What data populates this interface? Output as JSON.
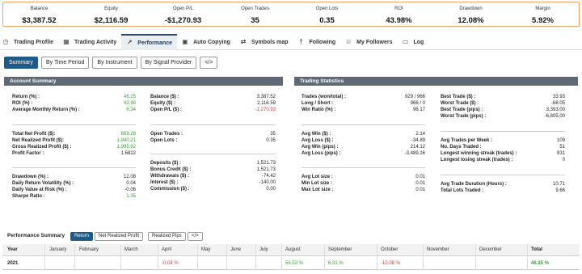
{
  "stats": [
    {
      "label": "Balance",
      "value": "$3,387.52"
    },
    {
      "label": "Equity",
      "value": "$2,116.59"
    },
    {
      "label": "Open P/L",
      "value": "-$1,270.93"
    },
    {
      "label": "Open Trades",
      "value": "35"
    },
    {
      "label": "Open Lots",
      "value": "0.35"
    },
    {
      "label": "ROI",
      "value": "43.98%"
    },
    {
      "label": "Drawdown",
      "value": "12.08%"
    },
    {
      "label": "Margin",
      "value": "5.92%"
    }
  ],
  "tabs": [
    {
      "label": "Trading Profile",
      "icon": "clock-icon"
    },
    {
      "label": "Trading Activity",
      "icon": "calendar-icon"
    },
    {
      "label": "Performance",
      "icon": "chart-line-icon"
    },
    {
      "label": "Auto Copying",
      "icon": "briefcase-icon"
    },
    {
      "label": "Symbols map",
      "icon": "arrows-icon"
    },
    {
      "label": "Following",
      "icon": "walking-person-icon"
    },
    {
      "label": "My Followers",
      "icon": "people-icon"
    },
    {
      "label": "Log",
      "icon": "document-icon"
    }
  ],
  "active_tab": "Performance",
  "subtabs": {
    "summary": "Summary",
    "by_time_period": "By Time Period",
    "by_instrument": "By Instrument",
    "by_signal_provider": "By Signal Provider",
    "embed": "</>"
  },
  "account_summary": {
    "title": "Account Summary",
    "left_groups": [
      [
        {
          "label": "Return (%) :",
          "value": "46.25",
          "color": "green"
        },
        {
          "label": "ROI (%) :",
          "value": "43.98",
          "color": "green"
        },
        {
          "label": "Average Monthly Return (%) :",
          "value": "6.34",
          "color": "green"
        }
      ],
      [
        {
          "label": "Total Net Profit ($):",
          "value": "669.28",
          "color": "green"
        },
        {
          "label": "Net Realized Profit ($):",
          "value": "1,940.21",
          "color": "green"
        },
        {
          "label": "Gross Realized Profit ($) :",
          "value": "1,995.62",
          "color": "green"
        },
        {
          "label": "Profit Factor :",
          "value": "1.6822",
          "color": "dark"
        }
      ],
      [
        {
          "label": "Drawdown (%) :",
          "value": "12.08",
          "color": "dark"
        },
        {
          "label": "Daily Return Volatility (%) :",
          "value": "0.04",
          "color": "dark"
        },
        {
          "label": "Daily Value at Risk (%) :",
          "value": "-0.06",
          "color": "dark"
        },
        {
          "label": "Sharpe Ratio :",
          "value": "1.35",
          "color": "green"
        }
      ]
    ],
    "right_groups": [
      [
        {
          "label": "Balance ($) :",
          "value": "3,387.52",
          "color": "dark"
        },
        {
          "label": "Equity ($) :",
          "value": "2,116.59",
          "color": "dark"
        },
        {
          "label": "Open P/L ($) :",
          "value": "-1,270.93",
          "color": "red"
        }
      ],
      [
        {
          "label": "Open Trades :",
          "value": "35",
          "color": "dark"
        },
        {
          "label": "Open Lots :",
          "value": "0.35",
          "color": "dark"
        }
      ],
      [
        {
          "label": "Deposits ($) :",
          "value": "1,521.73",
          "color": "dark"
        },
        {
          "label": "Bonus Credit ($) :",
          "value": "1,521.73",
          "color": "dark"
        },
        {
          "label": "Withdrawals ($) :",
          "value": "-74.42",
          "color": "dark"
        },
        {
          "label": "Interest ($) :",
          "value": "-140.00",
          "color": "dark"
        },
        {
          "label": "Commission ($) :",
          "value": "0.00",
          "color": "dark"
        }
      ]
    ]
  },
  "trading_statistics": {
    "title": "Trading Statistics",
    "left_groups": [
      [
        {
          "label": "Trades (won/total) :",
          "value": "929 / 966"
        },
        {
          "label": "Long / Short :",
          "value": "966 / 0"
        },
        {
          "label": "Win Ratio (%) :",
          "value": "96.17"
        }
      ],
      [
        {
          "label": "Avg Win ($) :",
          "value": "2.14"
        },
        {
          "label": "Avg Loss ($) :",
          "value": "-34.89"
        },
        {
          "label": "Avg Win (pips) :",
          "value": "214.12"
        },
        {
          "label": "Avg Loss (pips) :",
          "value": "-3,489.26"
        }
      ],
      [
        {
          "label": "Avg Lot size :",
          "value": "0.01"
        },
        {
          "label": "Min Lot size :",
          "value": "0.01"
        },
        {
          "label": "Max Lot size :",
          "value": "0.01"
        }
      ]
    ],
    "right_groups": [
      [
        {
          "label": "Best Trade ($) :",
          "value": "33.93"
        },
        {
          "label": "Worst Trade ($) :",
          "value": "-68.05"
        },
        {
          "label": "Best Trade (pips) :",
          "value": "3,393.00"
        },
        {
          "label": "Worst Trade (pips) :",
          "value": "-6,805.00"
        }
      ],
      [
        {
          "label": "Avg Trades per Week :",
          "value": "109"
        },
        {
          "label": "No. Days Traded :",
          "value": "51"
        },
        {
          "label": "Longest winning streak (trades) :",
          "value": "931"
        },
        {
          "label": "Longest losing streak (trades) :",
          "value": "0"
        }
      ],
      [
        {
          "label": "Avg Trade Duration (Hours) :",
          "value": "10.71"
        },
        {
          "label": "Total Lots Traded :",
          "value": "9.66"
        }
      ]
    ]
  },
  "performance_summary": {
    "title": "Performance Summary",
    "buttons": [
      "Return",
      "Net Realized Profit",
      "Realized Pips",
      "</>"
    ],
    "columns": [
      "Year",
      "January",
      "February",
      "March",
      "April",
      "May",
      "June",
      "July",
      "August",
      "September",
      "October",
      "November",
      "December",
      "Total"
    ],
    "rows": [
      {
        "cells": [
          "2021",
          "",
          "",
          "",
          "-0.04 %",
          "",
          "",
          "",
          "56.53 %",
          "6.31 %",
          "-12.08 %",
          "",
          "",
          "46.25 %"
        ],
        "colors": [
          "dark",
          "",
          "",
          "",
          "red",
          "",
          "",
          "",
          "green",
          "green",
          "red",
          "",
          "",
          "green"
        ]
      }
    ]
  }
}
